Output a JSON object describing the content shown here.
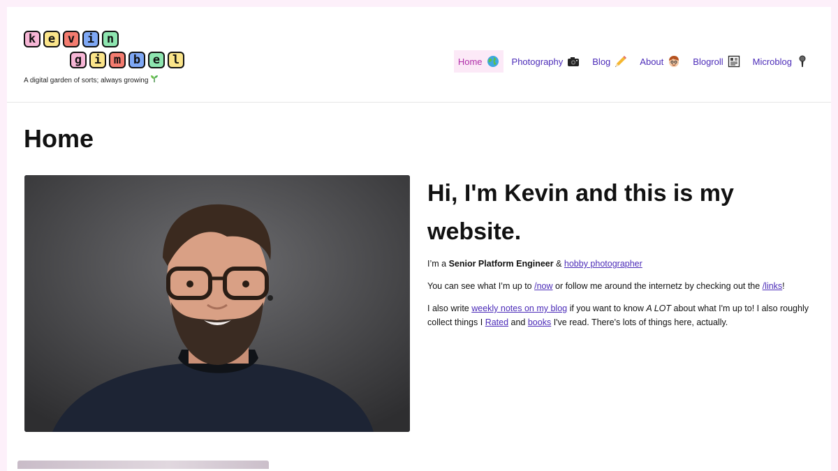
{
  "site": {
    "logo_row1": [
      "k",
      "e",
      "v",
      "i",
      "n"
    ],
    "logo_row2": [
      "g",
      "i",
      "m",
      "b",
      "e",
      "l"
    ],
    "logo_colors_row1": [
      "#f7b6d6",
      "#fbe58a",
      "#f47c70",
      "#7fa8f5",
      "#8ee6b0"
    ],
    "logo_colors_row2": [
      "#f7b6d6",
      "#fbe58a",
      "#f47c70",
      "#7fa8f5",
      "#8ee6b0",
      "#fbe58a"
    ],
    "tagline": "A digital garden of sorts; always growing"
  },
  "nav": {
    "items": [
      {
        "label": "Home",
        "icon": "globe-icon",
        "active": true
      },
      {
        "label": "Photography",
        "icon": "camera-icon",
        "active": false
      },
      {
        "label": "Blog",
        "icon": "pencil-icon",
        "active": false
      },
      {
        "label": "About",
        "icon": "face-icon",
        "active": false
      },
      {
        "label": "Blogroll",
        "icon": "newspaper-icon",
        "active": false
      },
      {
        "label": "Microblog",
        "icon": "microphone-icon",
        "active": false
      }
    ]
  },
  "main": {
    "title": "Home",
    "intro": {
      "heading": "Hi, I'm Kevin and this is my website.",
      "p1_prefix": "I’m a ",
      "p1_bold": "Senior Platform Engineer",
      "p1_mid": " & ",
      "p1_link": "hobby photographer",
      "p2_prefix": "You can see what I’m up to ",
      "p2_link1": "/now",
      "p2_mid": " or follow me around the internetz by checking out the ",
      "p2_link2": "/links",
      "p2_suffix": "!",
      "p3_prefix": "I also write ",
      "p3_link1": "weekly notes on my blog",
      "p3_mid1": " if you want to know ",
      "p3_em": "A LOT",
      "p3_mid2": " about what I'm up to! I also roughly collect things I ",
      "p3_link2": "Rated",
      "p3_mid3": " and ",
      "p3_link3": "books",
      "p3_suffix": " I've read. There's lots of things here, actually."
    }
  },
  "colors": {
    "page_bg": "#fdf0fa",
    "link": "#4b2bb8",
    "nav_active_bg": "#fce9f7",
    "nav_active_text": "#b02fa9"
  }
}
